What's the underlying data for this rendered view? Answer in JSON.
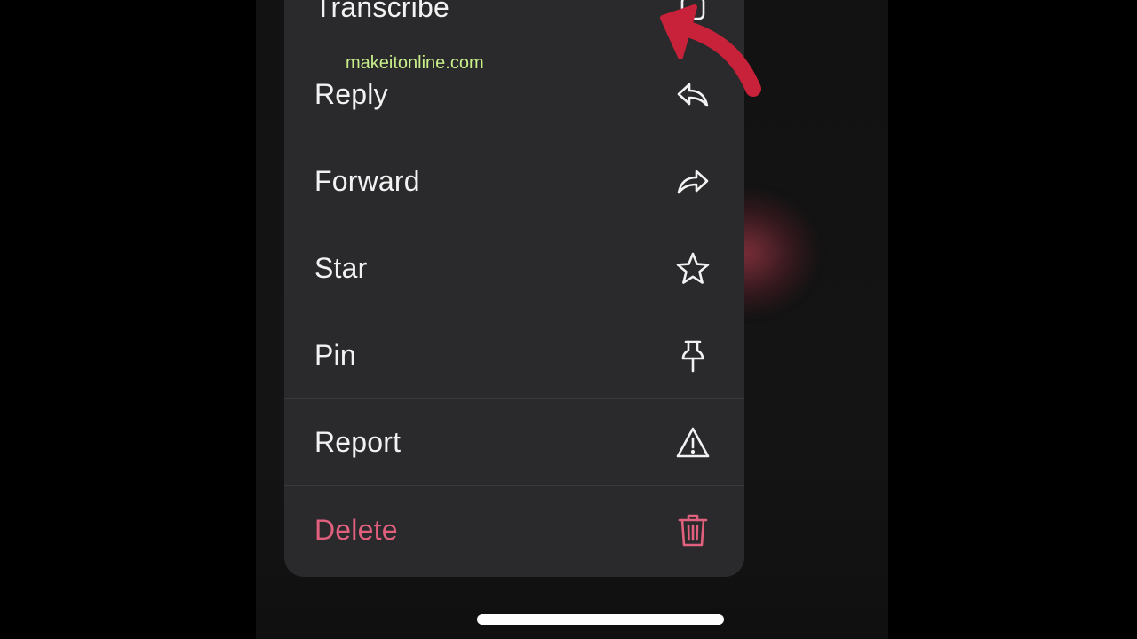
{
  "watermark": "makeitonline.com",
  "menu": {
    "items": [
      {
        "label": "Transcribe",
        "icon": "transcribe-icon"
      },
      {
        "label": "Reply",
        "icon": "reply-icon"
      },
      {
        "label": "Forward",
        "icon": "forward-icon"
      },
      {
        "label": "Star",
        "icon": "star-icon"
      },
      {
        "label": "Pin",
        "icon": "pin-icon"
      },
      {
        "label": "Report",
        "icon": "warning-icon"
      },
      {
        "label": "Delete",
        "icon": "trash-icon",
        "color": "#e0607e"
      }
    ]
  },
  "annotation": {
    "color": "#c8213a",
    "icon": "curved-arrow-icon"
  },
  "colors": {
    "menu_background": "#2a2a2c",
    "text": "#f2f2f2",
    "danger": "#e0607e",
    "watermark": "#c8ef8a"
  }
}
